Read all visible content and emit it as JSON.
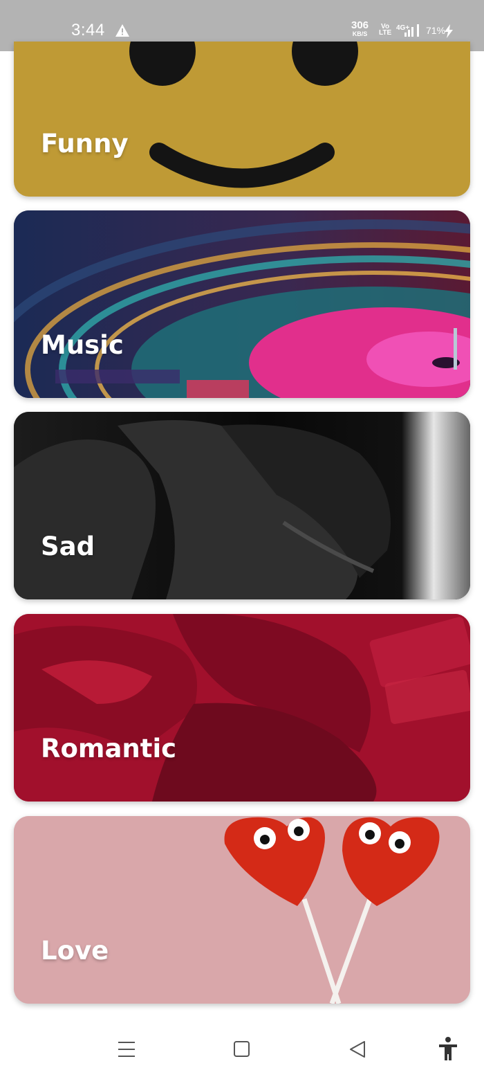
{
  "status_bar": {
    "time": "3:44",
    "net_speed_value": "306",
    "net_speed_unit": "KB/S",
    "volte_top": "Vo",
    "volte_bottom": "LTE",
    "network_type": "4G+",
    "battery": "71%",
    "icons": [
      "alert-triangle-icon",
      "signal-icon",
      "charging-bolt-icon"
    ]
  },
  "categories": [
    {
      "label": "Funny",
      "theme": "#bf9a35"
    },
    {
      "label": "Music",
      "theme": "#e0348f"
    },
    {
      "label": "Sad",
      "theme": "#0a0a0a"
    },
    {
      "label": "Romantic",
      "theme": "#a1102c"
    },
    {
      "label": "Love",
      "theme": "#d9a7aa"
    }
  ],
  "nav_bar": {
    "icons": [
      "menu-icon",
      "home-square-icon",
      "back-triangle-icon",
      "accessibility-icon"
    ]
  }
}
